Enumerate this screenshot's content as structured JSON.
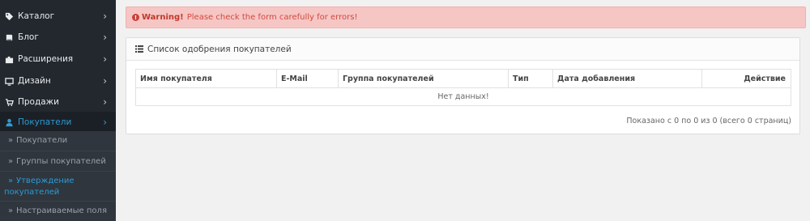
{
  "sidebar": {
    "items": [
      {
        "label": "Каталог",
        "icon": "tag-icon"
      },
      {
        "label": "Блог",
        "icon": "book-icon"
      },
      {
        "label": "Расширения",
        "icon": "puzzle-icon"
      },
      {
        "label": "Дизайн",
        "icon": "monitor-icon"
      },
      {
        "label": "Продажи",
        "icon": "cart-icon"
      },
      {
        "label": "Покупатели",
        "icon": "user-icon"
      }
    ],
    "submenu": [
      {
        "label": "Покупатели"
      },
      {
        "label": "Группы покупателей"
      },
      {
        "label_line1": "Утверждение",
        "label_line2": "покупателей"
      },
      {
        "label": "Настраиваемые поля"
      }
    ],
    "active_color": "#2c9bd6"
  },
  "alert": {
    "strong": "Warning!",
    "text": "Please check the form carefully for errors!"
  },
  "panel": {
    "title": "Список одобрения покупателей",
    "columns": [
      "Имя покупателя",
      "E-Mail",
      "Группа покупателей",
      "Тип",
      "Дата добавления",
      "Действие"
    ],
    "empty_text": "Нет данных!",
    "pagination": "Показано с 0 по 0 из 0 (всего 0 страниц)"
  }
}
